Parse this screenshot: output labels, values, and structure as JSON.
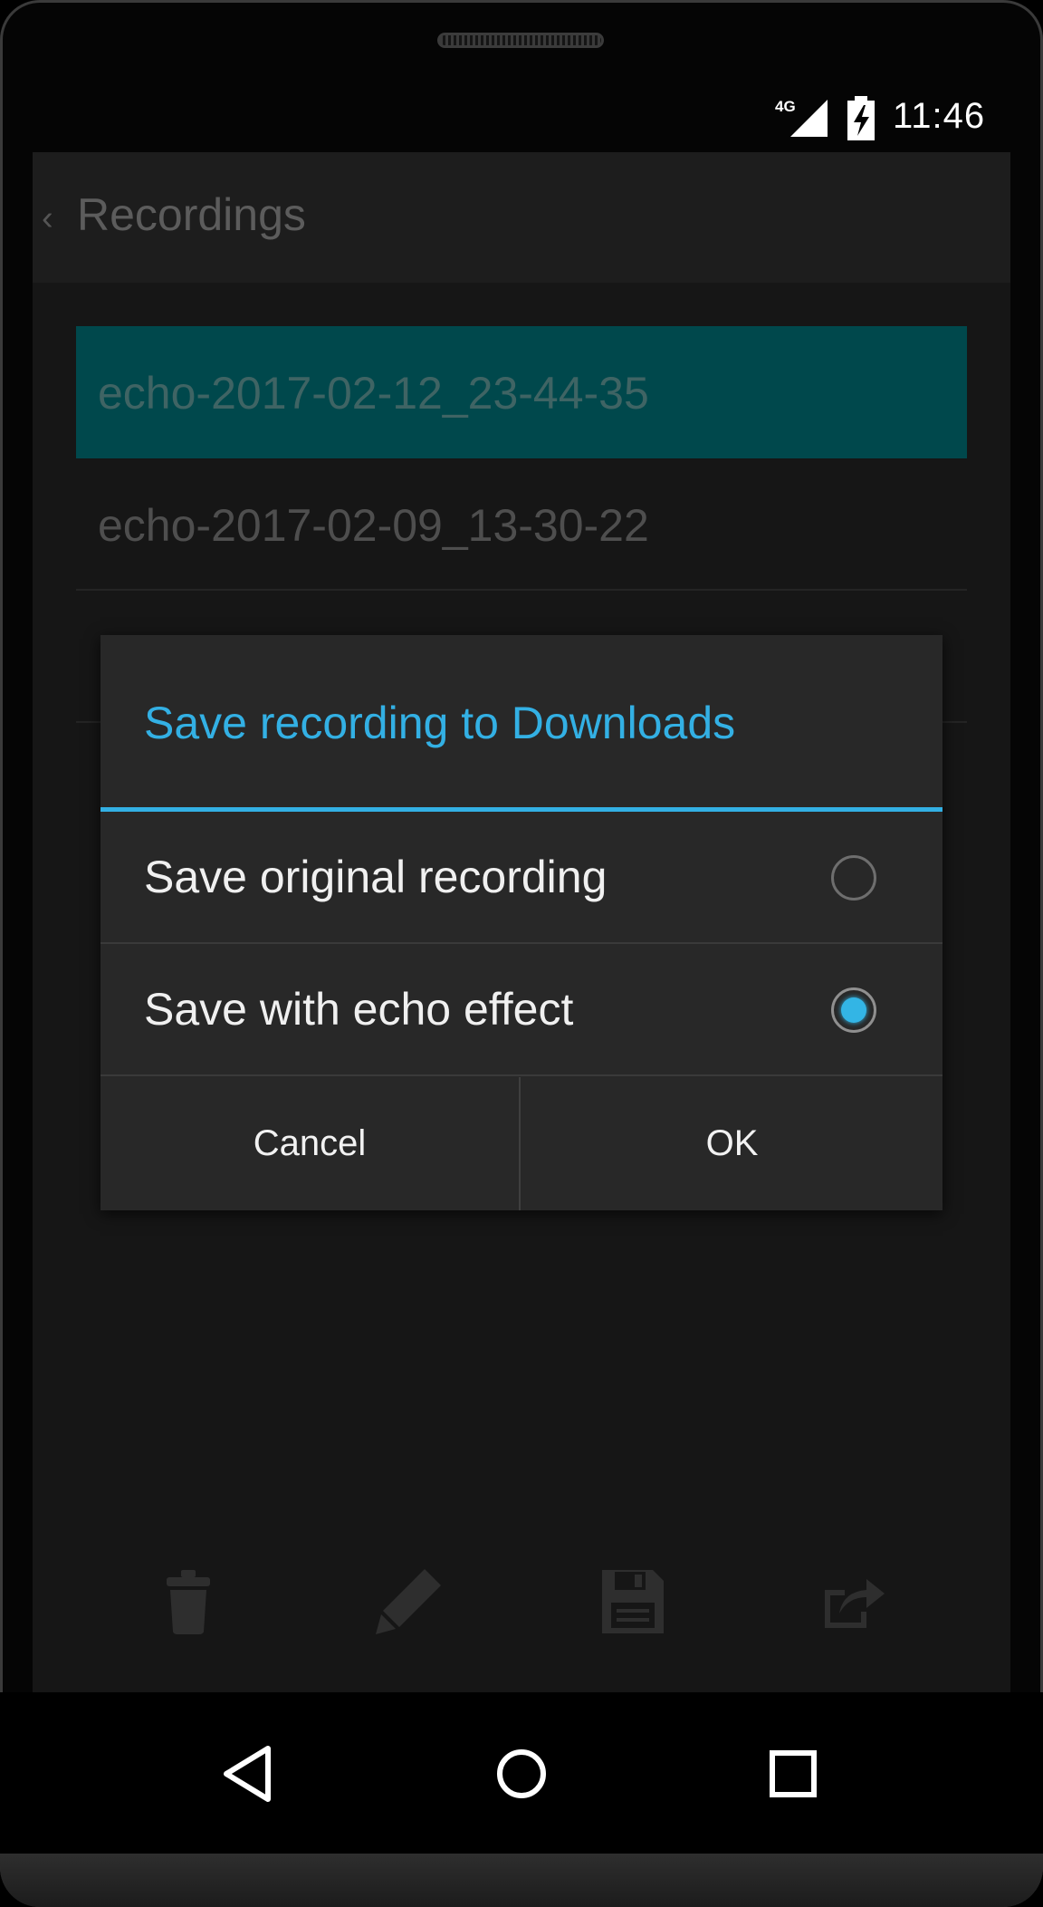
{
  "status_bar": {
    "network": "4G",
    "time": "11:46"
  },
  "action_bar": {
    "title": "Recordings"
  },
  "recordings": [
    {
      "name": "echo-2017-02-12_23-44-35",
      "selected": true
    },
    {
      "name": "echo-2017-02-09_13-30-22",
      "selected": false
    },
    {
      "name": "",
      "selected": false
    }
  ],
  "dialog": {
    "title": "Save recording to Downloads",
    "options": [
      {
        "label": "Save original recording",
        "checked": false
      },
      {
        "label": "Save with echo effect",
        "checked": true
      }
    ],
    "cancel_label": "Cancel",
    "ok_label": "OK"
  },
  "toolbar": {
    "icons": [
      "trash-icon",
      "pencil-icon",
      "save-icon",
      "share-icon"
    ]
  },
  "colors": {
    "accent": "#33b5e5",
    "selected_row": "#00484c"
  }
}
